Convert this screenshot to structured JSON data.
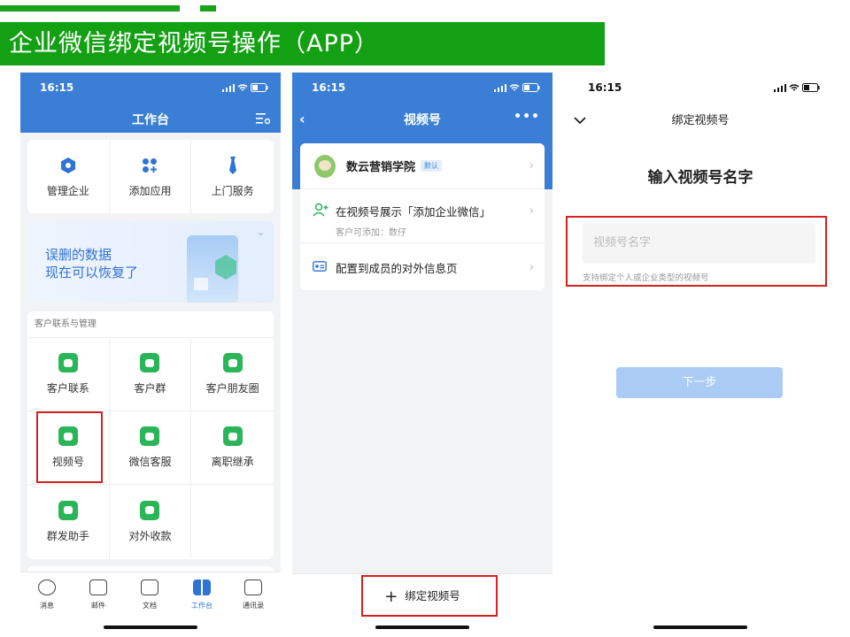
{
  "banner": {
    "title": "企业微信绑定视频号操作（APP）"
  },
  "status_time": "16:15",
  "phone1": {
    "title": "工作台",
    "top_grid": [
      {
        "label": "管理企业",
        "icon": "hexagon-icon"
      },
      {
        "label": "添加应用",
        "icon": "add-apps-icon"
      },
      {
        "label": "上门服务",
        "icon": "tie-icon"
      }
    ],
    "promo": {
      "line1": "误删的数据",
      "line2": "现在可以恢复了"
    },
    "section_title": "客户联系与管理",
    "grid": [
      {
        "label": "客户联系",
        "icon": "chat-icon"
      },
      {
        "label": "客户群",
        "icon": "group-icon"
      },
      {
        "label": "客户朋友圈",
        "icon": "moments-icon"
      },
      {
        "label": "视频号",
        "icon": "channels-icon"
      },
      {
        "label": "微信客服",
        "icon": "service-icon"
      },
      {
        "label": "离职继承",
        "icon": "document-icon"
      },
      {
        "label": "群发助手",
        "icon": "megaphone-icon"
      },
      {
        "label": "对外收款",
        "icon": "payment-icon"
      }
    ],
    "tabs": [
      {
        "label": "消息",
        "icon": "message-icon"
      },
      {
        "label": "邮件",
        "icon": "mail-icon"
      },
      {
        "label": "文档",
        "icon": "doc-icon"
      },
      {
        "label": "工作台",
        "icon": "workbench-icon"
      },
      {
        "label": "通讯录",
        "icon": "contacts-icon"
      }
    ]
  },
  "phone2": {
    "title": "视频号",
    "account_name": "数云营销学院",
    "default_badge": "默认",
    "row2_title": "在视频号展示「添加企业微信」",
    "row2_sub": "客户可添加：数仔",
    "row3_title": "配置到成员的对外信息页",
    "bind_button": "绑定视频号"
  },
  "phone3": {
    "title": "绑定视频号",
    "heading": "输入视频号名字",
    "input_placeholder": "视频号名字",
    "hint": "支持绑定个人或企业类型的视频号",
    "next_button": "下一步"
  }
}
